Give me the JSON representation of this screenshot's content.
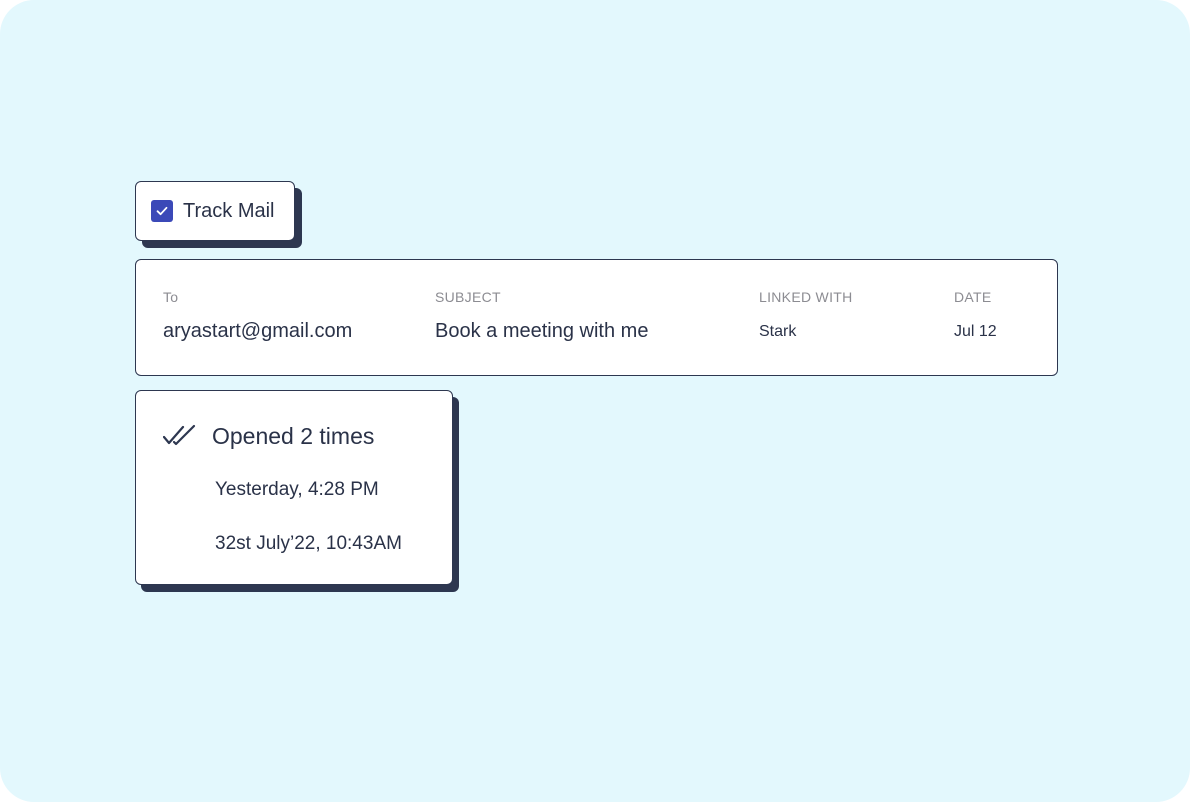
{
  "track": {
    "label": "Track Mail",
    "checked": true,
    "check_color": "#3b49b8"
  },
  "mail": {
    "columns": [
      {
        "header": "To",
        "value": "aryastart@gmail.com"
      },
      {
        "header": "SUBJECT",
        "value": "Book a meeting with me"
      },
      {
        "header": "LINKED WITH",
        "value": "Stark"
      },
      {
        "header": "DATE",
        "value": "Jul 12"
      }
    ]
  },
  "opened": {
    "title": "Opened 2 times",
    "icon": "double-check-icon",
    "entries": [
      "Yesterday, 4:28 PM",
      "32st July’22, 10:43AM"
    ]
  },
  "colors": {
    "background": "#e3f8fd",
    "ink": "#2d3750",
    "muted": "#8c8c92"
  }
}
